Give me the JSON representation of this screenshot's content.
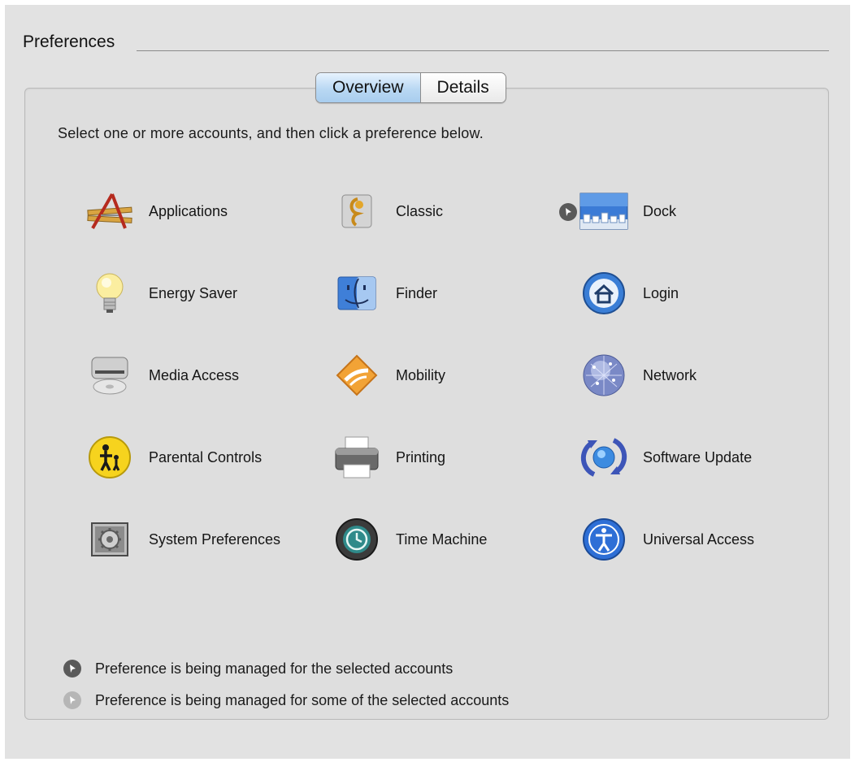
{
  "section_title": "Preferences",
  "tabs": [
    {
      "label": "Overview",
      "active": true
    },
    {
      "label": "Details",
      "active": false
    }
  ],
  "instruction": "Select one or more accounts, and then click a preference below.",
  "preferences": [
    {
      "label": "Applications",
      "icon": "applications-icon",
      "managed": "none"
    },
    {
      "label": "Classic",
      "icon": "classic-icon",
      "managed": "none"
    },
    {
      "label": "Dock",
      "icon": "dock-icon",
      "managed": "all"
    },
    {
      "label": "Energy Saver",
      "icon": "lightbulb-icon",
      "managed": "none"
    },
    {
      "label": "Finder",
      "icon": "finder-icon",
      "managed": "none"
    },
    {
      "label": "Login",
      "icon": "home-icon",
      "managed": "none"
    },
    {
      "label": "Media Access",
      "icon": "media-drive-icon",
      "managed": "none"
    },
    {
      "label": "Mobility",
      "icon": "mobility-icon",
      "managed": "none"
    },
    {
      "label": "Network",
      "icon": "globe-icon",
      "managed": "none"
    },
    {
      "label": "Parental Controls",
      "icon": "parental-controls-icon",
      "managed": "none"
    },
    {
      "label": "Printing",
      "icon": "printer-icon",
      "managed": "none"
    },
    {
      "label": "Software Update",
      "icon": "software-update-icon",
      "managed": "none"
    },
    {
      "label": "System Preferences",
      "icon": "system-preferences-icon",
      "managed": "none"
    },
    {
      "label": "Time Machine",
      "icon": "time-machine-icon",
      "managed": "none"
    },
    {
      "label": "Universal Access",
      "icon": "universal-access-icon",
      "managed": "none"
    }
  ],
  "legend": [
    {
      "text": "Preference is being managed for the selected accounts",
      "icon": "managed-all-icon"
    },
    {
      "text": "Preference is being managed for some of the selected accounts",
      "icon": "managed-some-icon"
    }
  ]
}
